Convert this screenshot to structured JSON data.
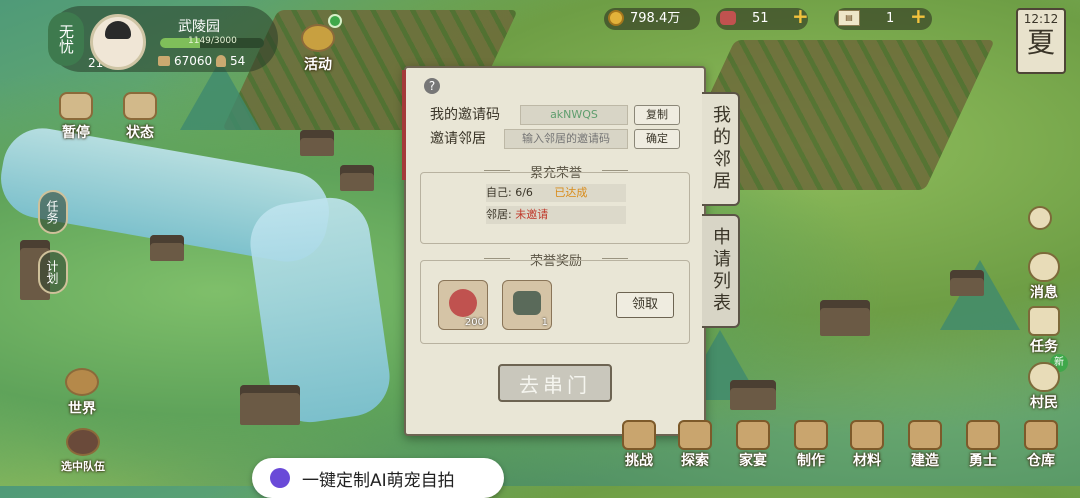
{
  "profile": {
    "status": "无忧",
    "level": "21",
    "estate": "武陵园",
    "exp": "1149/3000",
    "population": "67060",
    "workers": "54"
  },
  "resources": {
    "coins": "798.4万",
    "gems": "51",
    "tickets": "1"
  },
  "clock": {
    "time": "12:12",
    "season": "夏"
  },
  "left_menu": {
    "pause": "暂停",
    "status": "状态",
    "activity": "活动",
    "tasks": "任务",
    "plan": "计划",
    "world": "世界",
    "team": "选中队伍"
  },
  "invite_panel": {
    "my_code_label": "我的邀请码",
    "my_code_value": "akNWQS",
    "copy_label": "复制",
    "invite_neighbor_label": "邀请邻居",
    "invite_placeholder": "输入邻居的邀请码",
    "confirm_label": "确定",
    "honor_title": "累充荣誉",
    "self_label": "自己: 6/6",
    "self_status": "已达成",
    "neighbor_label": "邻居: ",
    "neighbor_status": "未邀请",
    "reward_title": "荣誉奖励",
    "rewards": [
      {
        "name": "red-seal-token",
        "count": "200"
      },
      {
        "name": "jade-stone",
        "count": "1"
      }
    ],
    "claim_label": "领取",
    "visit_label": "去串门",
    "help_icon": "?"
  },
  "side_tabs": {
    "my_neighbors": "我的邻居",
    "applications": "申请列表"
  },
  "right_menu": {
    "messages": "消息",
    "tasks": "任务",
    "tasks_badge": "新",
    "villagers": "村民"
  },
  "bottom_menu": [
    "挑战",
    "探索",
    "家宴",
    "制作",
    "材料",
    "建造",
    "勇士",
    "仓库"
  ],
  "notification": "一键定制AI萌宠自拍",
  "colors": {
    "panel_bg": "#e9e6d6",
    "accent_gold": "#f2c23d",
    "status_red": "#c0392b",
    "status_orange": "#d98c1a"
  }
}
